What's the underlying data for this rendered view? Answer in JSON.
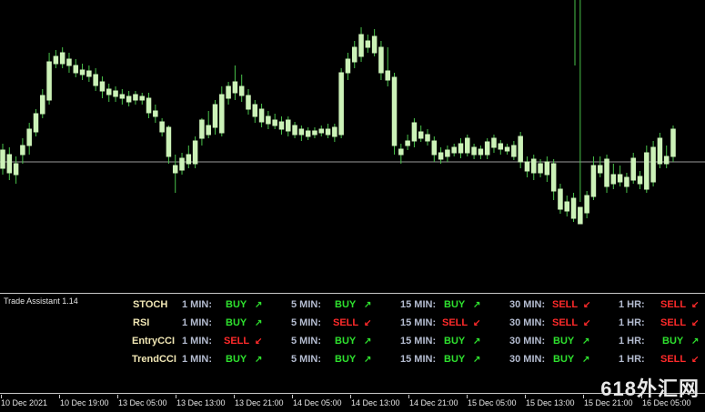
{
  "chart": {
    "bull_color": "#ccf2b8",
    "bear_color": "#ccf2b8",
    "wick_color": "#49c24a",
    "price_line_color": "#9a9a9a",
    "candles": [
      [
        155,
        135,
        128,
        162
      ],
      [
        150,
        130,
        122,
        158
      ],
      [
        140,
        128,
        118,
        148
      ],
      [
        160,
        150,
        140,
        168
      ],
      [
        178,
        160,
        150,
        185
      ],
      [
        195,
        175,
        170,
        200
      ],
      [
        215,
        195,
        190,
        222
      ],
      [
        252,
        210,
        205,
        262
      ],
      [
        258,
        250,
        245,
        265
      ],
      [
        262,
        250,
        245,
        268
      ],
      [
        255,
        248,
        240,
        262
      ],
      [
        248,
        240,
        235,
        255
      ],
      [
        243,
        238,
        232,
        250
      ],
      [
        242,
        236,
        230,
        248
      ],
      [
        238,
        226,
        220,
        245
      ],
      [
        230,
        220,
        212,
        236
      ],
      [
        222,
        216,
        208,
        228
      ],
      [
        220,
        214,
        208,
        225
      ],
      [
        216,
        212,
        205,
        222
      ],
      [
        214,
        208,
        203,
        220
      ],
      [
        216,
        210,
        205,
        220
      ],
      [
        214,
        210,
        205,
        218
      ],
      [
        212,
        196,
        190,
        218
      ],
      [
        198,
        192,
        185,
        205
      ],
      [
        186,
        175,
        170,
        190
      ],
      [
        180,
        148,
        140,
        182
      ],
      [
        138,
        130,
        108,
        150
      ],
      [
        146,
        133,
        128,
        152
      ],
      [
        150,
        140,
        135,
        160
      ],
      [
        165,
        140,
        135,
        170
      ],
      [
        188,
        168,
        160,
        190
      ],
      [
        182,
        172,
        168,
        198
      ],
      [
        205,
        180,
        172,
        210
      ],
      [
        216,
        174,
        170,
        225
      ],
      [
        225,
        212,
        205,
        230
      ],
      [
        230,
        218,
        210,
        248
      ],
      [
        225,
        215,
        208,
        238
      ],
      [
        215,
        200,
        194,
        222
      ],
      [
        205,
        192,
        185,
        210
      ],
      [
        200,
        186,
        180,
        206
      ],
      [
        192,
        184,
        178,
        198
      ],
      [
        188,
        182,
        178,
        195
      ],
      [
        186,
        178,
        172,
        192
      ],
      [
        188,
        176,
        170,
        192
      ],
      [
        182,
        172,
        168,
        186
      ],
      [
        178,
        172,
        165,
        182
      ],
      [
        176,
        170,
        166,
        180
      ],
      [
        176,
        172,
        168,
        180
      ],
      [
        178,
        174,
        170,
        182
      ],
      [
        178,
        172,
        168,
        184
      ],
      [
        180,
        170,
        164,
        184
      ],
      [
        240,
        172,
        168,
        245
      ],
      [
        255,
        240,
        232,
        262
      ],
      [
        268,
        252,
        245,
        275
      ],
      [
        282,
        258,
        252,
        290
      ],
      [
        275,
        268,
        262,
        282
      ],
      [
        280,
        262,
        258,
        288
      ],
      [
        268,
        240,
        232,
        275
      ],
      [
        242,
        232,
        225,
        268
      ],
      [
        235,
        160,
        150,
        240
      ],
      [
        156,
        150,
        140,
        162
      ],
      [
        165,
        160,
        155,
        172
      ],
      [
        185,
        165,
        158,
        190
      ],
      [
        175,
        168,
        164,
        182
      ],
      [
        172,
        165,
        160,
        178
      ],
      [
        165,
        150,
        142,
        170
      ],
      [
        152,
        145,
        140,
        158
      ],
      [
        155,
        148,
        142,
        160
      ],
      [
        158,
        152,
        148,
        162
      ],
      [
        162,
        152,
        146,
        168
      ],
      [
        168,
        152,
        148,
        172
      ],
      [
        158,
        150,
        145,
        162
      ],
      [
        156,
        150,
        145,
        160
      ],
      [
        164,
        150,
        145,
        168
      ],
      [
        168,
        158,
        152,
        172
      ],
      [
        162,
        156,
        150,
        166
      ],
      [
        158,
        154,
        150,
        162
      ],
      [
        160,
        148,
        144,
        165
      ],
      [
        170,
        142,
        135,
        175
      ],
      [
        142,
        132,
        125,
        148
      ],
      [
        145,
        130,
        122,
        150
      ],
      [
        140,
        130,
        125,
        145
      ],
      [
        142,
        128,
        120,
        148
      ],
      [
        140,
        110,
        100,
        145
      ],
      [
        112,
        90,
        85,
        118
      ],
      [
        98,
        88,
        82,
        105
      ],
      [
        102,
        80,
        76,
        108
      ],
      [
        92,
        74,
        0,
        98
      ],
      [
        105,
        86,
        80,
        110
      ],
      [
        138,
        104,
        100,
        148
      ],
      [
        138,
        130,
        125,
        148
      ],
      [
        145,
        115,
        108,
        150
      ],
      [
        128,
        118,
        112,
        140
      ],
      [
        128,
        120,
        115,
        138
      ],
      [
        125,
        115,
        108,
        130
      ],
      [
        146,
        122,
        118,
        152
      ],
      [
        126,
        118,
        112,
        132
      ],
      [
        152,
        112,
        108,
        160
      ],
      [
        158,
        120,
        115,
        165
      ],
      [
        168,
        140,
        135,
        174
      ],
      [
        148,
        140,
        135,
        160
      ],
      [
        178,
        148,
        142,
        182
      ]
    ]
  },
  "indicator_panel": {
    "title": "Trade Assistant 1.14",
    "rows": [
      {
        "label": "STOCH",
        "signals": [
          {
            "tf": "1 MIN:",
            "signal": "BUY"
          },
          {
            "tf": "5 MIN:",
            "signal": "BUY"
          },
          {
            "tf": "15 MIN:",
            "signal": "BUY"
          },
          {
            "tf": "30 MIN:",
            "signal": "SELL"
          },
          {
            "tf": "1 HR:",
            "signal": "SELL"
          }
        ]
      },
      {
        "label": "RSI",
        "signals": [
          {
            "tf": "1 MIN:",
            "signal": "BUY"
          },
          {
            "tf": "5 MIN:",
            "signal": "SELL"
          },
          {
            "tf": "15 MIN:",
            "signal": "SELL"
          },
          {
            "tf": "30 MIN:",
            "signal": "SELL"
          },
          {
            "tf": "1 HR:",
            "signal": "SELL"
          }
        ]
      },
      {
        "label": "EntryCCI",
        "signals": [
          {
            "tf": "1 MIN:",
            "signal": "SELL"
          },
          {
            "tf": "5 MIN:",
            "signal": "BUY"
          },
          {
            "tf": "15 MIN:",
            "signal": "BUY"
          },
          {
            "tf": "30 MIN:",
            "signal": "BUY"
          },
          {
            "tf": "1 HR:",
            "signal": "BUY"
          }
        ]
      },
      {
        "label": "TrendCCI",
        "signals": [
          {
            "tf": "1 MIN:",
            "signal": "BUY"
          },
          {
            "tf": "5 MIN:",
            "signal": "BUY"
          },
          {
            "tf": "15 MIN:",
            "signal": "BUY"
          },
          {
            "tf": "30 MIN:",
            "signal": "BUY"
          },
          {
            "tf": "1 HR:",
            "signal": "SELL"
          }
        ]
      }
    ],
    "colors": {
      "buy": "#2ee02e",
      "sell": "#ff2a2a"
    },
    "buy_icon": "arrow-up-icon",
    "sell_icon": "arrow-down-icon"
  },
  "time_axis": {
    "labels": [
      "10 Dec 2021",
      "10 Dec 19:00",
      "13 Dec 05:00",
      "13 Dec 13:00",
      "13 Dec 21:00",
      "14 Dec 05:00",
      "14 Dec 13:00",
      "14 Dec 21:00",
      "15 Dec 05:00",
      "15 Dec 13:00",
      "15 Dec 21:00",
      "16 Dec 05:00"
    ]
  },
  "watermark": "618外汇网"
}
